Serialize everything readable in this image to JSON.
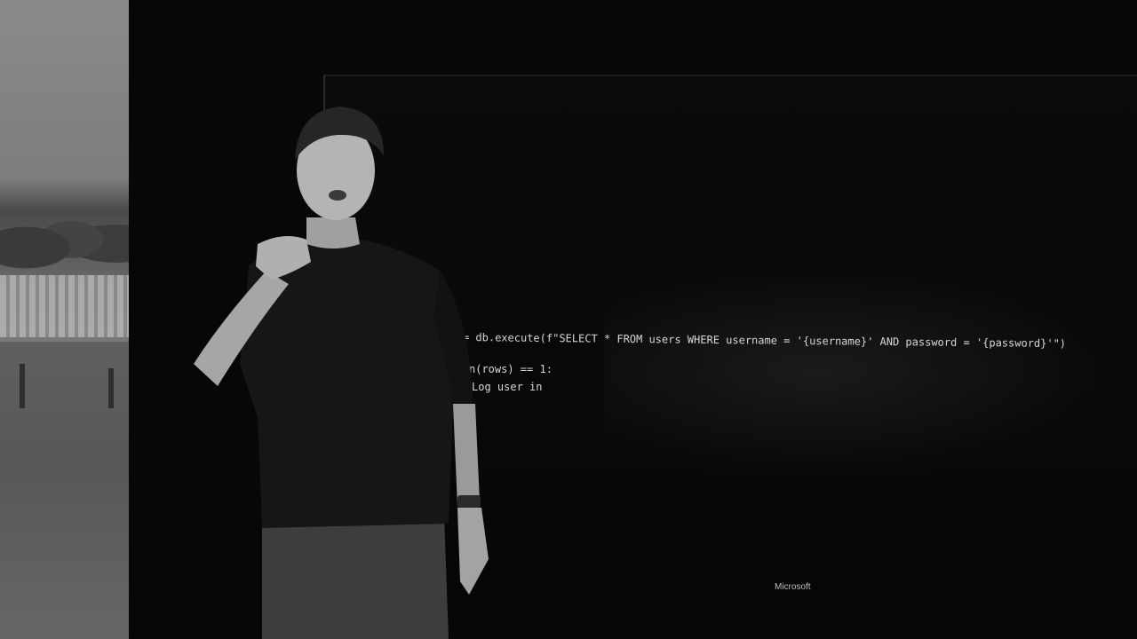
{
  "scene": {
    "description_icon": "presenter-on-stage",
    "colors": {
      "background": "#070707",
      "code_text": "#d8d8d8",
      "brand_text": "#bfbfbf"
    }
  },
  "projection": {
    "code_lines": [
      "= db.execute(f\"SELECT * FROM users WHERE username = '{username}' AND password = '{password}'\")",
      "n(rows) == 1:",
      "Log user in"
    ],
    "brand_label": "Microsoft"
  }
}
